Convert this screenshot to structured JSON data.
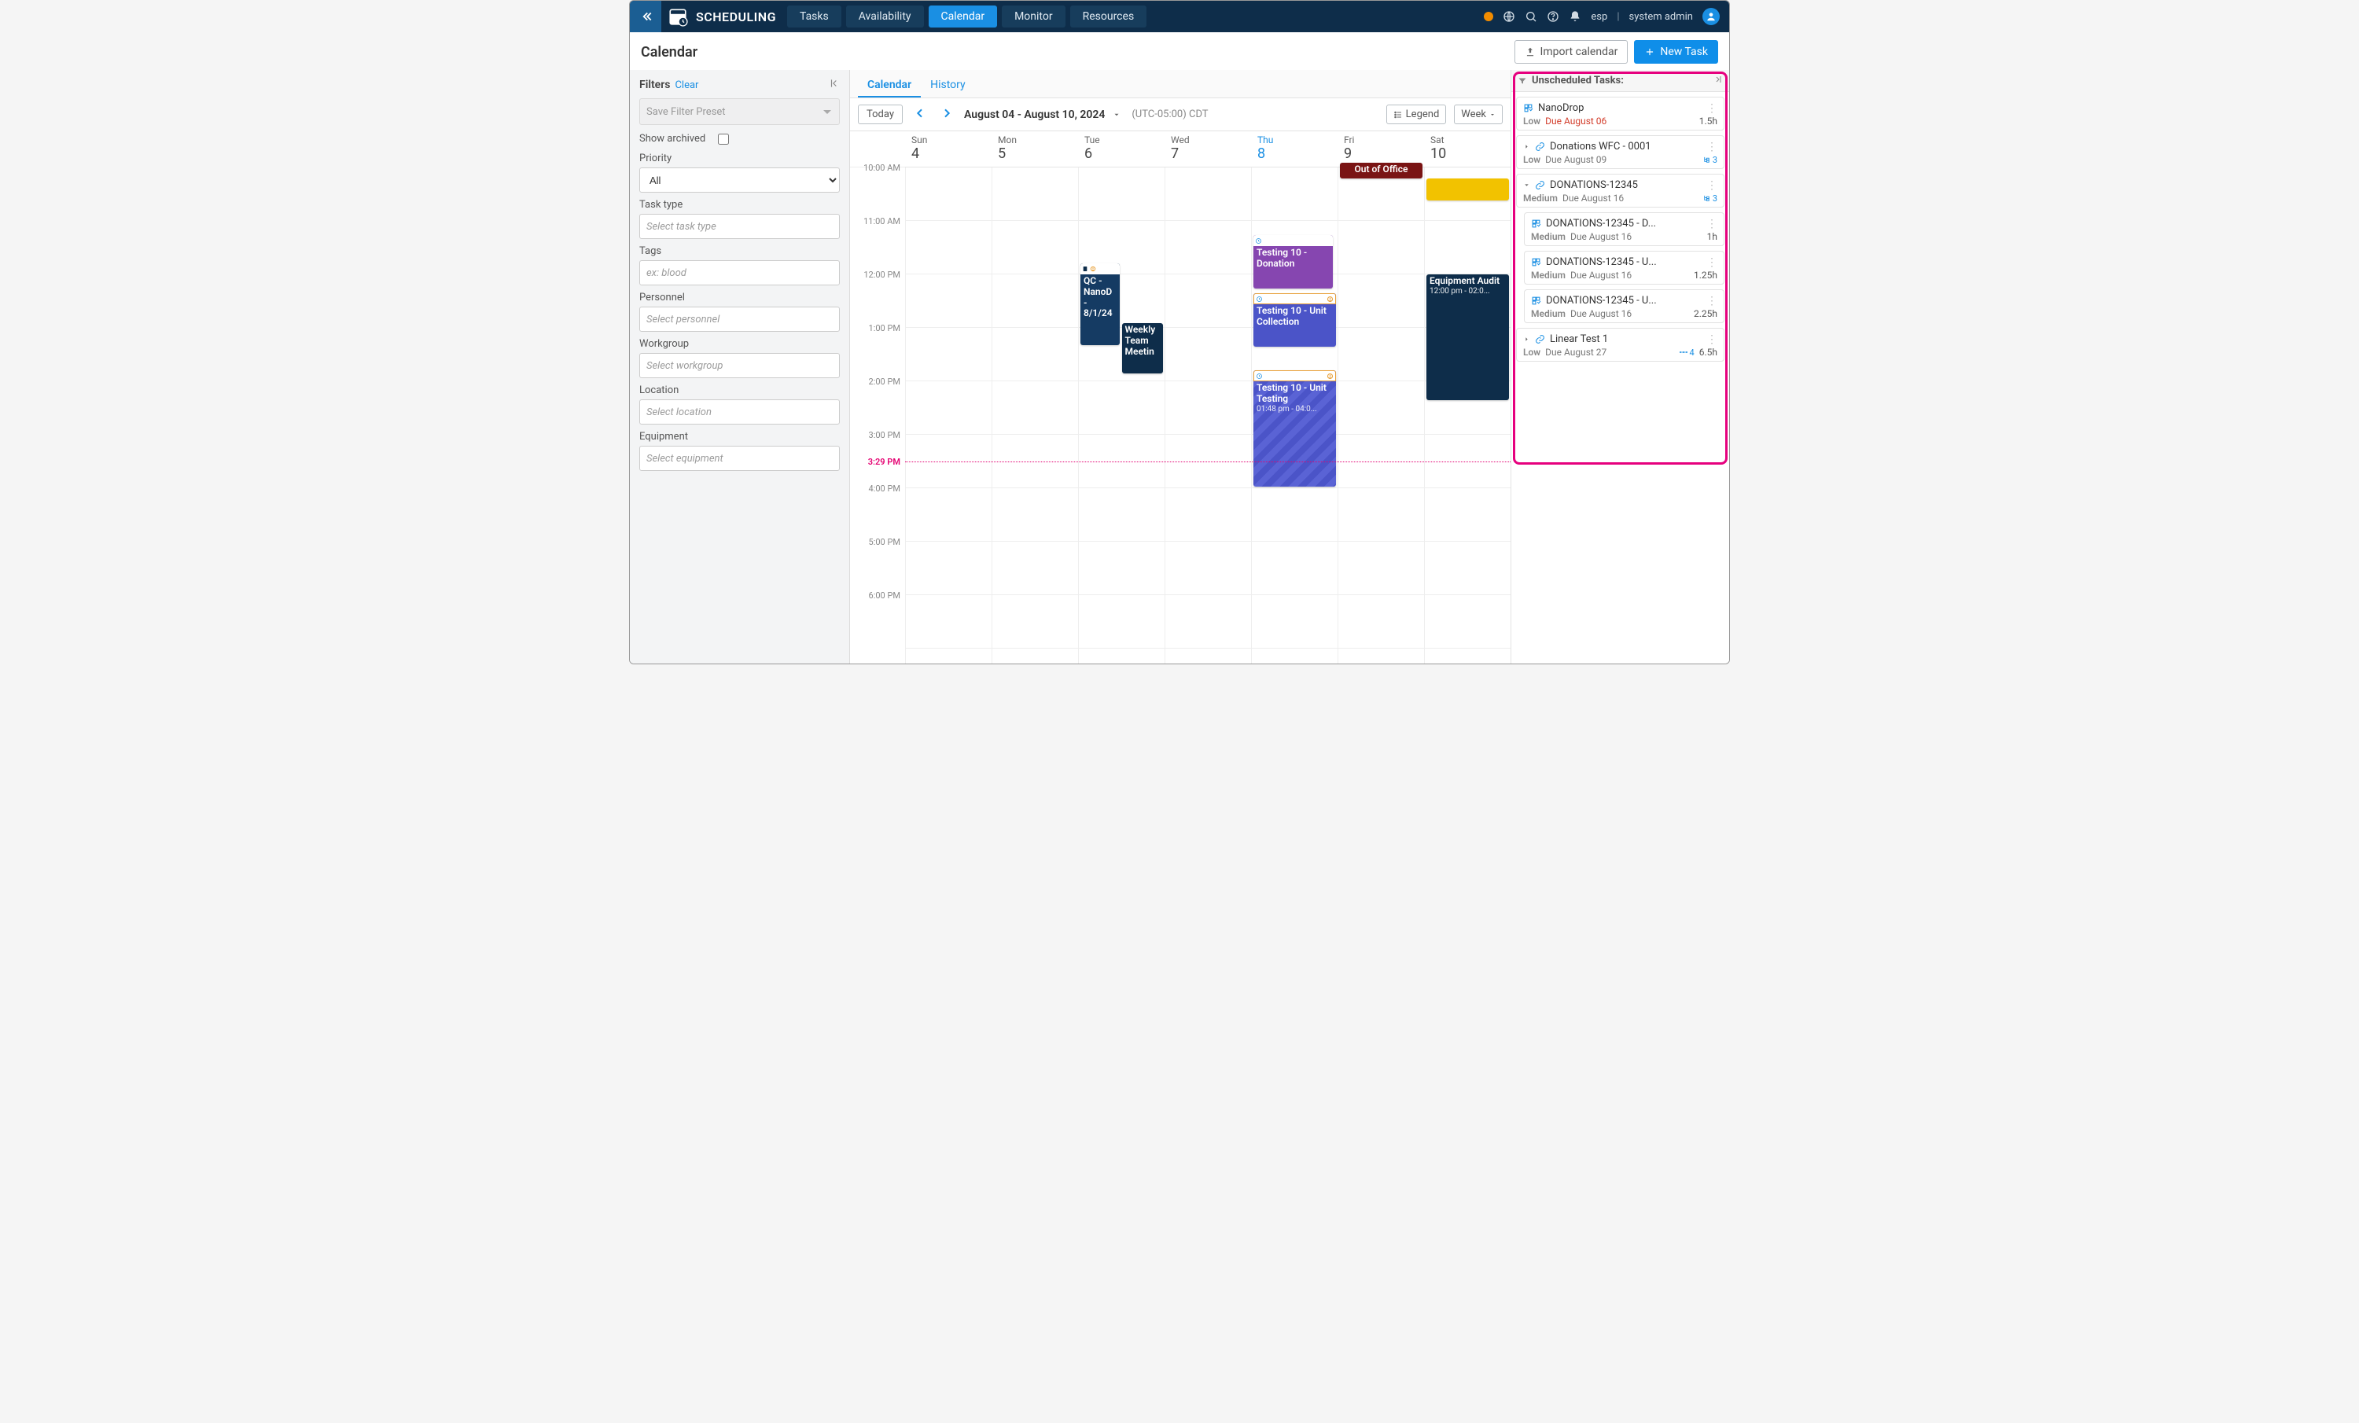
{
  "topnav": {
    "app": "SCHEDULING",
    "tabs": [
      "Tasks",
      "Availability",
      "Calendar",
      "Monitor",
      "Resources"
    ],
    "active_tab": "Calendar",
    "lang": "esp",
    "user": "system admin"
  },
  "header": {
    "title": "Calendar",
    "import_label": "Import calendar",
    "new_task_label": "New Task"
  },
  "filters": {
    "title": "Filters",
    "clear": "Clear",
    "preset_placeholder": "Save Filter Preset",
    "show_archived": "Show archived",
    "priority_label": "Priority",
    "priority_value": "All",
    "task_type_label": "Task type",
    "task_type_placeholder": "Select task type",
    "tags_label": "Tags",
    "tags_placeholder": "ex: blood",
    "personnel_label": "Personnel",
    "personnel_placeholder": "Select personnel",
    "workgroup_label": "Workgroup",
    "workgroup_placeholder": "Select workgroup",
    "location_label": "Location",
    "location_placeholder": "Select location",
    "equipment_label": "Equipment",
    "equipment_placeholder": "Select equipment"
  },
  "calendar": {
    "subtabs": [
      "Calendar",
      "History"
    ],
    "active_subtab": "Calendar",
    "today_btn": "Today",
    "range": "August 04 - August 10, 2024",
    "tz": "(UTC-05:00) CDT",
    "legend": "Legend",
    "view": "Week",
    "days": [
      {
        "dow": "Sun",
        "dom": "4"
      },
      {
        "dow": "Mon",
        "dom": "5"
      },
      {
        "dow": "Tue",
        "dom": "6"
      },
      {
        "dow": "Wed",
        "dom": "7"
      },
      {
        "dow": "Thu",
        "dom": "8",
        "today": true
      },
      {
        "dow": "Fri",
        "dom": "9"
      },
      {
        "dow": "Sat",
        "dom": "10"
      }
    ],
    "hours": [
      "10:00 AM",
      "11:00 AM",
      "12:00 PM",
      "1:00 PM",
      "2:00 PM",
      "3:00 PM",
      "4:00 PM",
      "5:00 PM",
      "6:00 PM"
    ],
    "now_label": "3:29 PM",
    "events": {
      "ooo": "Out of Office",
      "qc": {
        "line1": "QC -",
        "line2": "NanoD",
        "line3": "-",
        "line4": "8/1/24"
      },
      "meeting": {
        "line1": "Weekly",
        "line2": "Team",
        "line3": "Meetin"
      },
      "t10_donation": "Testing 10 - Donation",
      "t10_unit_collection": "Testing 10 - Unit Collection",
      "t10_unit_testing": {
        "title": "Testing 10 - Unit Testing",
        "time": "01:48 pm - 04:0..."
      },
      "equip_audit": {
        "title": "Equipment Audit",
        "time": "12:00 pm - 02:0..."
      }
    }
  },
  "unscheduled": {
    "title": "Unscheduled Tasks:",
    "items": [
      {
        "icon": "task",
        "title": "NanoDrop",
        "priority": "Low",
        "due": "Due August 06",
        "overdue": true,
        "hours": "1.5h"
      },
      {
        "icon": "link",
        "chev": "right",
        "title": "Donations WFC - 0001",
        "priority": "Low",
        "due": "Due August 09",
        "badge": "3"
      },
      {
        "icon": "link",
        "chev": "down",
        "title": "DONATIONS-12345",
        "priority": "Medium",
        "due": "Due August 16",
        "badge": "3"
      },
      {
        "icon": "task",
        "sub": true,
        "title": "DONATIONS-12345 - D...",
        "priority": "Medium",
        "due": "Due August 16",
        "hours": "1h"
      },
      {
        "icon": "task",
        "sub": true,
        "title": "DONATIONS-12345 - U...",
        "priority": "Medium",
        "due": "Due August 16",
        "hours": "1.25h"
      },
      {
        "icon": "task",
        "sub": true,
        "title": "DONATIONS-12345 - U...",
        "priority": "Medium",
        "due": "Due August 16",
        "hours": "2.25h"
      },
      {
        "icon": "link",
        "chev": "right",
        "title": "Linear Test 1",
        "priority": "Low",
        "due": "Due August 27",
        "badge": "4",
        "badge_style": "dots",
        "hours": "6.5h"
      }
    ]
  }
}
